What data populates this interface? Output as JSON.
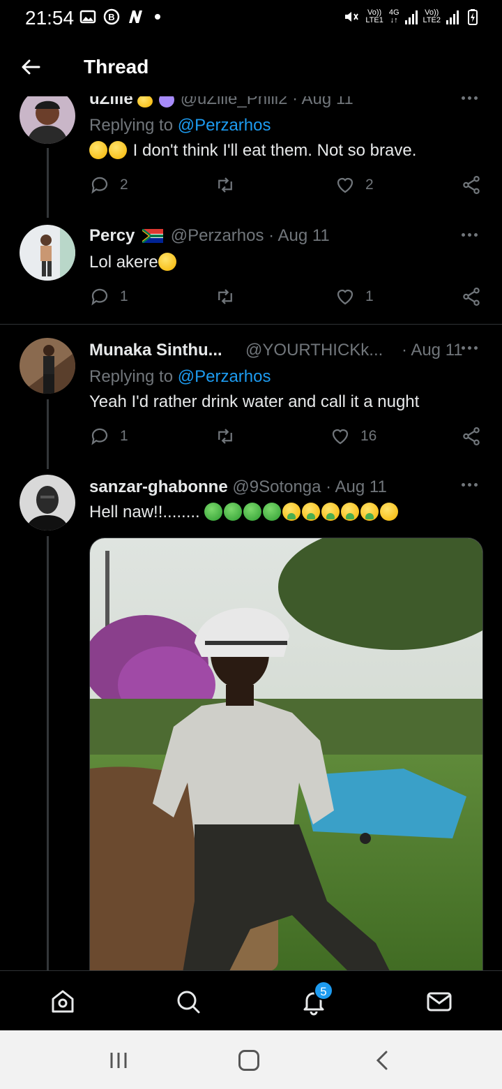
{
  "status_bar": {
    "time": "21:54",
    "left_icons": [
      "image-icon",
      "b-icon",
      "n-icon"
    ],
    "net1_top": "Vo))",
    "net1_bottom": "LTE1",
    "net_gen": "4G",
    "net2_top": "Vo))",
    "net2_bottom": "LTE2"
  },
  "header": {
    "title": "Thread"
  },
  "tweets": [
    {
      "name": "uZille",
      "handle": "@uZille_Phili2",
      "date": "· Aug 11",
      "replying_prefix": "Replying to",
      "replying_handle": "@Perzarhos",
      "text": "I don't think I'll eat them. Not so brave.",
      "replies": "2",
      "retweets": "",
      "likes": "2"
    },
    {
      "name": "Percy",
      "handle": "@Perzarhos",
      "date": "· Aug 11",
      "text": "Lol akere",
      "replies": "1",
      "retweets": "",
      "likes": "1"
    },
    {
      "name": "Munaka Sinthu...",
      "handle": "@YOURTHICKk...",
      "date": "· Aug 11",
      "replying_prefix": "Replying to",
      "replying_handle": "@Perzarhos",
      "text": "Yeah I'd rather drink water and call it a nught",
      "replies": "1",
      "retweets": "",
      "likes": "16"
    },
    {
      "name": "sanzar-ghabonne",
      "handle": "@9Sotonga",
      "date": "· Aug 11",
      "text": "Hell naw!!........"
    }
  ],
  "tabbar": {
    "notification_badge": "5"
  },
  "colors": {
    "accent": "#1d9bf0",
    "background": "#000000",
    "muted": "#71767b"
  }
}
